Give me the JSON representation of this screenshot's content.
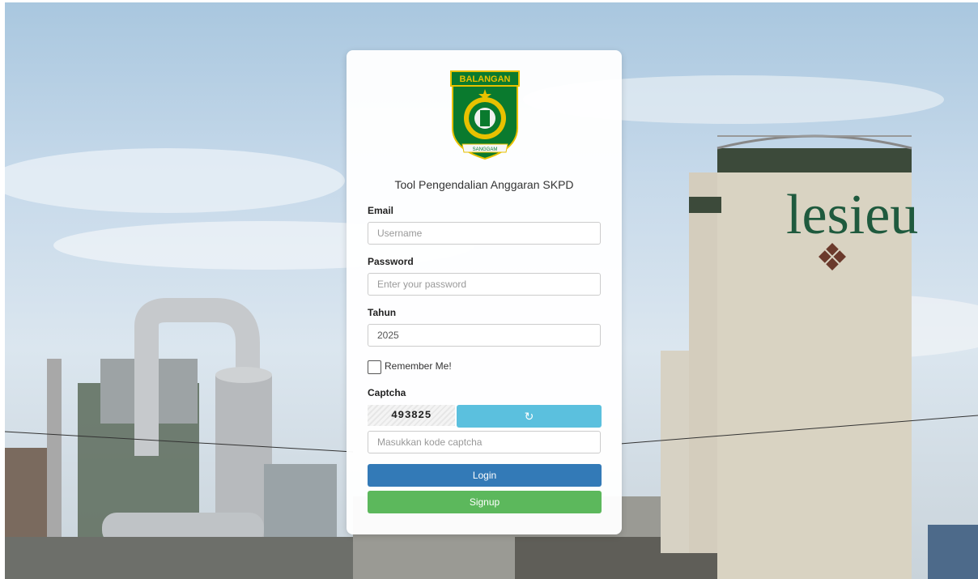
{
  "app": {
    "title": "Tool Pengendalian Anggaran SKPD",
    "logo_text": "BALANGAN",
    "logo_ribbon": "SANGGAM"
  },
  "background": {
    "sign_text": "lesieu"
  },
  "form": {
    "email_label": "Email",
    "email_placeholder": "Username",
    "email_value": "",
    "password_label": "Password",
    "password_placeholder": "Enter your password",
    "password_value": "",
    "year_label": "Tahun",
    "year_value": "2025",
    "remember_label": "Remember Me!",
    "remember_checked": false,
    "captcha_label": "Captcha",
    "captcha_code": "493825",
    "refresh_icon": "refresh-icon",
    "captcha_placeholder": "Masukkan kode captcha",
    "login_label": "Login",
    "signup_label": "Signup"
  },
  "colors": {
    "login": "#337ab7",
    "signup": "#5cb85c",
    "refresh": "#5bc0de"
  }
}
